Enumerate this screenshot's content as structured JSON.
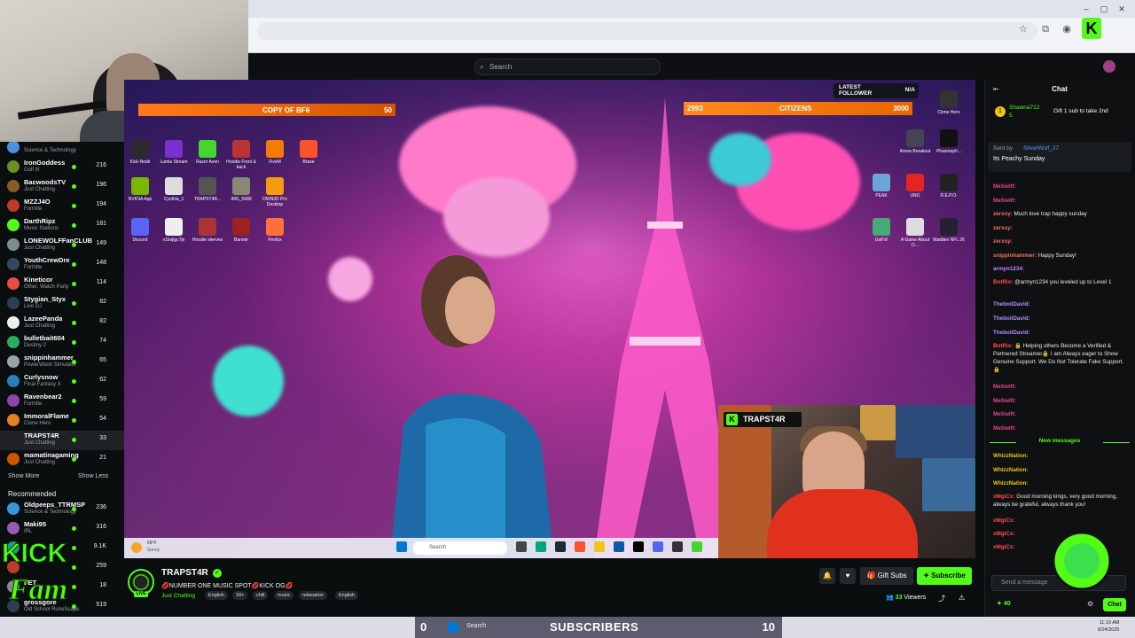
{
  "browser": {
    "window_controls": [
      "–",
      "▢",
      "✕"
    ],
    "toolbar_icons": [
      "star-icon",
      "extensions-icon",
      "profile-icon"
    ]
  },
  "header": {
    "search_placeholder": "Search"
  },
  "sidebar": {
    "channels": [
      {
        "name": "",
        "category": "Science & Technology",
        "viewers": "",
        "color": "#4a90e2"
      },
      {
        "name": "IronGoddess",
        "category": "Golf It!",
        "viewers": "216",
        "color": "#6b8e23"
      },
      {
        "name": "BacwoodsTV",
        "category": "Just Chatting",
        "viewers": "196",
        "color": "#8b5a2b"
      },
      {
        "name": "MZZJ4O",
        "category": "Fortnite",
        "viewers": "194",
        "color": "#c0392b"
      },
      {
        "name": "DarthRipz",
        "category": "Music Stations",
        "viewers": "181",
        "color": "#53fc18"
      },
      {
        "name": "LONEWOLFFanCLUB",
        "category": "Just Chatting",
        "viewers": "149",
        "color": "#7f8c8d"
      },
      {
        "name": "YouthCrewDre",
        "category": "Fortnite",
        "viewers": "148",
        "color": "#34495e"
      },
      {
        "name": "Kineticor",
        "category": "Other, Watch Party",
        "viewers": "114",
        "color": "#e74c3c"
      },
      {
        "name": "Stygian_Styx",
        "category": "Live DJ",
        "viewers": "82",
        "color": "#2c3e50"
      },
      {
        "name": "LazeePanda",
        "category": "Just Chatting",
        "viewers": "82",
        "color": "#ecf0f1"
      },
      {
        "name": "bulletbait604",
        "category": "Destiny 2",
        "viewers": "74",
        "color": "#27ae60"
      },
      {
        "name": "snippinhammer",
        "category": "PowerWash Simulator",
        "viewers": "65",
        "color": "#95a5a6"
      },
      {
        "name": "Curlysnow",
        "category": "Final Fantasy X",
        "viewers": "62",
        "color": "#2980b9"
      },
      {
        "name": "Ravenbear2",
        "category": "Fortnite",
        "viewers": "59",
        "color": "#8e44ad"
      },
      {
        "name": "ImmoralFlame",
        "category": "Clone Hero",
        "viewers": "54",
        "color": "#e67e22"
      },
      {
        "name": "TRAPST4R",
        "category": "Just Chatting",
        "viewers": "33",
        "color": "#222"
      },
      {
        "name": "mamatinagaming",
        "category": "Just Chatting",
        "viewers": "21",
        "color": "#d35400"
      }
    ],
    "show_more": "Show More",
    "show_less": "Show Less",
    "recommended_title": "Recommended",
    "recommended": [
      {
        "name": "Oldpeeps_TTRMSP",
        "category": "Science & Technology",
        "viewers": "236",
        "color": "#3498db"
      },
      {
        "name": "Maki95",
        "category": "IRL",
        "viewers": "316",
        "color": "#9b59b6"
      },
      {
        "name": "",
        "category": "",
        "viewers": "9.1K",
        "color": "#16a085"
      },
      {
        "name": "",
        "category": "",
        "viewers": "259",
        "color": "#c0392b"
      },
      {
        "name": "LET",
        "category": "",
        "viewers": "18",
        "color": "#7f8c8d"
      },
      {
        "name": "grossgore",
        "category": "Old School RuneScape",
        "viewers": "519",
        "color": "#2c3e50"
      }
    ]
  },
  "overlay": {
    "goal_left_label": "COPY OF BF6",
    "goal_left_value": "50",
    "goal_right_current": "2993",
    "goal_right_label": "CITIZENS",
    "goal_right_target": "3000",
    "latest_follower_label": "LATEST FOLLOWER",
    "latest_follower_value": "N/A",
    "cam2_label": "TRAPST4R",
    "weather_temp": "68°F",
    "weather_desc": "Sunny",
    "taskbar_search": "Search",
    "desktop_icons": [
      "Kick-Nedir",
      "Lumia Stream",
      "Razer Axon",
      "Hoodie Front & back",
      "FiveM",
      "Brave",
      "NVIDIA App",
      "Cynthia_1",
      "TRAPST4R...",
      "IMG_5689",
      "DWN3D Pro Desktop",
      "Discord",
      "v1bvjlgc7je",
      "Hoodie sleeves",
      "Banner",
      "Firefox",
      "Clone Hero",
      "Arena Breakout",
      "Phasmoph...",
      "PEAK",
      "UNO",
      "R.E.P.O.",
      "Golf it!",
      "A Game About D...",
      "Madden NFL 26"
    ]
  },
  "stream_info": {
    "streamer": "TRAPST4R",
    "live": "LIVE",
    "title": "💋NUMBER ONE MUSIC SPOT💋KICK OG💋",
    "category": "Just Chatting",
    "tags": [
      "English",
      "18+",
      "chill",
      "music",
      "relaxation",
      "English"
    ],
    "gift_subs": "Gift Subs",
    "subscribe": "Subscribe",
    "viewers_count": "33",
    "viewers_label": "Viewers"
  },
  "chat": {
    "title": "Chat",
    "gift_user": "Shawna712",
    "gift_count": "5",
    "gift_text": "Gift 1 sub to take 2nd",
    "pinned_by": "Sent by",
    "pinned_user": "SilverWolf_27",
    "pinned_text": "Its Peachy Sunday",
    "messages": [
      {
        "user": "MeSwift:",
        "text": "",
        "color": "#e84393"
      },
      {
        "user": "MeSwift:",
        "text": "",
        "color": "#e84393"
      },
      {
        "user": "zerxsy:",
        "text": "Much love trap happy sunday",
        "color": "#ff6b6b"
      },
      {
        "user": "zerxsy:",
        "text": "",
        "color": "#ff6b6b"
      },
      {
        "user": "zerxsy:",
        "text": "",
        "color": "#ff6b6b"
      },
      {
        "user": "snippinhammer:",
        "text": "Happy Sunday!",
        "color": "#ff6b6b"
      },
      {
        "user": "armyn1234:",
        "text": "",
        "color": "#b58cff"
      },
      {
        "user": "BotRix:",
        "text": "@armyn1234 you leveled up to Level 1",
        "color": "#ff4d4d"
      },
      {
        "user": "TheboiiDavid:",
        "text": "",
        "color": "#b58cff"
      },
      {
        "user": "TheboiiDavid:",
        "text": "",
        "color": "#b58cff"
      },
      {
        "user": "TheboiiDavid:",
        "text": "",
        "color": "#b58cff"
      },
      {
        "user": "BotRix:",
        "text": "🔒 Helping others Become a Verified & Partnered Streamer🔒 I am Always eager to Show Genuine Support. We Do Not Tolerate Fake Support. 🔒",
        "color": "#ff4d4d"
      },
      {
        "user": "MeSwift:",
        "text": "",
        "color": "#e84393"
      },
      {
        "user": "MeSwift:",
        "text": "",
        "color": "#e84393"
      },
      {
        "user": "MeSwift:",
        "text": "",
        "color": "#e84393"
      },
      {
        "user": "MeSwift:",
        "text": "",
        "color": "#e84393"
      }
    ],
    "new_messages": "New messages",
    "new": [
      {
        "user": "WhizzNation:",
        "text": "",
        "color": "#f1c40f"
      },
      {
        "user": "WhizzNation:",
        "text": "",
        "color": "#f1c40f"
      },
      {
        "user": "WhizzNation:",
        "text": "",
        "color": "#f1c40f"
      },
      {
        "user": "xMgiCx:",
        "text": "Good morning kings, very good morning, always be grateful, always thank you!",
        "color": "#ff4d4d"
      },
      {
        "user": "xMgiCx:",
        "text": "",
        "color": "#ff4d4d"
      },
      {
        "user": "xMgiCx:",
        "text": "",
        "color": "#ff4d4d"
      },
      {
        "user": "xMgiCx:",
        "text": "",
        "color": "#ff4d4d"
      }
    ],
    "input_placeholder": "Send a message",
    "points": "40",
    "send_label": "Chat"
  },
  "windows": {
    "sub_left": "0",
    "sub_label": "SUBSCRIBERS",
    "sub_right": "10",
    "search": "Search",
    "time": "11:19 AM",
    "date": "8/24/2025"
  },
  "colors": {
    "kick_green": "#53fc18",
    "overlay_orange": "#ff7b1c"
  }
}
